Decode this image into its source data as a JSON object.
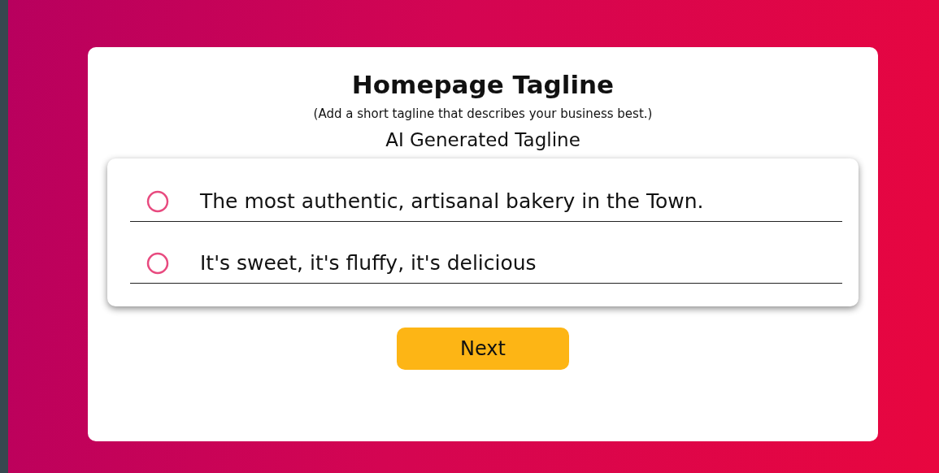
{
  "title": "Homepage Tagline",
  "subtitle": "(Add a short tagline that describes your business best.)",
  "section_label": "AI Generated Tagline",
  "options": [
    {
      "text": "The most authentic, artisanal bakery in the Town.",
      "selected": false
    },
    {
      "text": "It's sweet, it's fluffy, it's delicious",
      "selected": false
    }
  ],
  "next_button": "Next"
}
